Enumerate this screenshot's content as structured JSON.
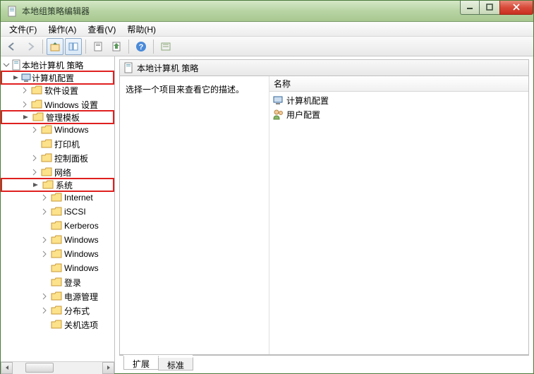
{
  "window": {
    "title": "本地组策略编辑器"
  },
  "menu": {
    "file": "文件(F)",
    "action": "操作(A)",
    "view": "查看(V)",
    "help": "帮助(H)"
  },
  "tree": {
    "root": "本地计算机 策略",
    "computer_config": "计算机配置",
    "software_settings": "软件设置",
    "windows_settings": "Windows 设置",
    "admin_templates": "管理模板",
    "windows": "Windows",
    "printer": "打印机",
    "control_panel": "控制面板",
    "network": "网络",
    "system": "系统",
    "internet": "Internet",
    "iscsi": "iSCSI",
    "kerberos": "Kerberos",
    "windc1": "Windows",
    "windc2": "Windows",
    "windc3": "Windows",
    "login": "登录",
    "power": "电源管理",
    "distributed": "分布式",
    "shutdown": "关机选项"
  },
  "content": {
    "header": "本地计算机 策略",
    "description": "选择一个项目来查看它的描述。",
    "col_name": "名称",
    "items": {
      "computer": "计算机配置",
      "user": "用户配置"
    }
  },
  "tabs": {
    "extended": "扩展",
    "standard": "标准"
  }
}
